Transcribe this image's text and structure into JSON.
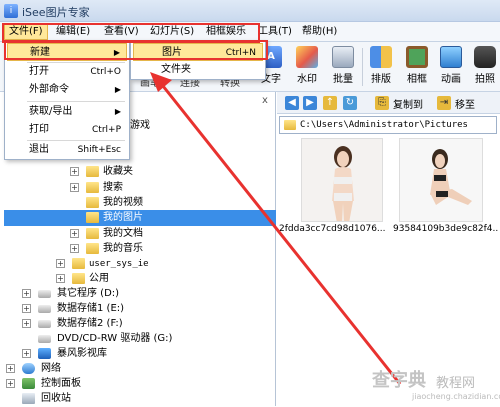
{
  "window": {
    "title": "iSee图片专家",
    "app_icon": "i"
  },
  "menubar": [
    {
      "label": "文件(F)",
      "active": true
    },
    {
      "label": "编辑(E)"
    },
    {
      "label": "查看(V)"
    },
    {
      "label": "幻灯片(S)"
    },
    {
      "label": "相框娱乐"
    },
    {
      "label": "工具(T)"
    },
    {
      "label": "帮助(H)"
    }
  ],
  "toolbar": {
    "partial_labels": [
      "画笔",
      "连接",
      "转换"
    ],
    "tools": [
      {
        "label": "文字",
        "icon": "text-tool-icon"
      },
      {
        "label": "水印",
        "icon": "watermark-icon"
      },
      {
        "label": "批量",
        "icon": "batch-icon"
      },
      {
        "label": "排版",
        "icon": "layout-icon"
      },
      {
        "label": "相框",
        "icon": "frame-icon"
      },
      {
        "label": "动画",
        "icon": "animation-icon"
      },
      {
        "label": "拍照",
        "icon": "camera-icon"
      }
    ]
  },
  "file_menu": [
    {
      "label": "新建",
      "shortcut": "",
      "has_submenu": true,
      "hover": true
    },
    {
      "label": "打开",
      "shortcut": "Ctrl+O",
      "has_submenu": false
    },
    {
      "label": "外部命令",
      "shortcut": "",
      "has_submenu": true
    },
    {
      "label": "获取/导出",
      "shortcut": "",
      "has_submenu": true
    },
    {
      "label": "打印",
      "shortcut": "Ctrl+P",
      "has_submenu": false
    },
    {
      "label": "退出",
      "shortcut": "Shift+Esc",
      "has_submenu": false
    }
  ],
  "new_submenu": [
    {
      "label": "图片",
      "shortcut": "Ctrl+N",
      "hover": true
    },
    {
      "label": "文件夹",
      "shortcut": ""
    }
  ],
  "tree": {
    "close_glyph": "x",
    "items": [
      {
        "label": "游戏"
      },
      {
        "label": "收藏夹"
      },
      {
        "label": "搜索"
      },
      {
        "label": "我的视频"
      },
      {
        "label": "我的图片",
        "selected": true
      },
      {
        "label": "我的文档"
      },
      {
        "label": "我的音乐"
      },
      {
        "label": "user_sys_ie"
      },
      {
        "label": "公用"
      },
      {
        "label": "其它程序 (D:)"
      },
      {
        "label": "数据存储1 (E:)"
      },
      {
        "label": "数据存储2 (F:)"
      },
      {
        "label": "DVD/CD-RW 驱动器 (G:)"
      },
      {
        "label": "暴风影视库"
      },
      {
        "label": "网络"
      },
      {
        "label": "控制面板"
      },
      {
        "label": "回收站"
      }
    ]
  },
  "browser": {
    "copy_to": "复制到",
    "move_to": "移至",
    "path": "C:\\Users\\Administrator\\Pictures",
    "files": [
      {
        "name": "2fdda3cc7cd98d1076..."
      },
      {
        "name": "93584109b3de9c82f4..."
      }
    ]
  },
  "watermark": {
    "logo": "查字典",
    "site": "教程网",
    "url": "jiaocheng.chazidian.com"
  },
  "colors": {
    "highlight": "#ffe89a",
    "selection": "#3a8ee8",
    "annotation": "#e8322f"
  }
}
